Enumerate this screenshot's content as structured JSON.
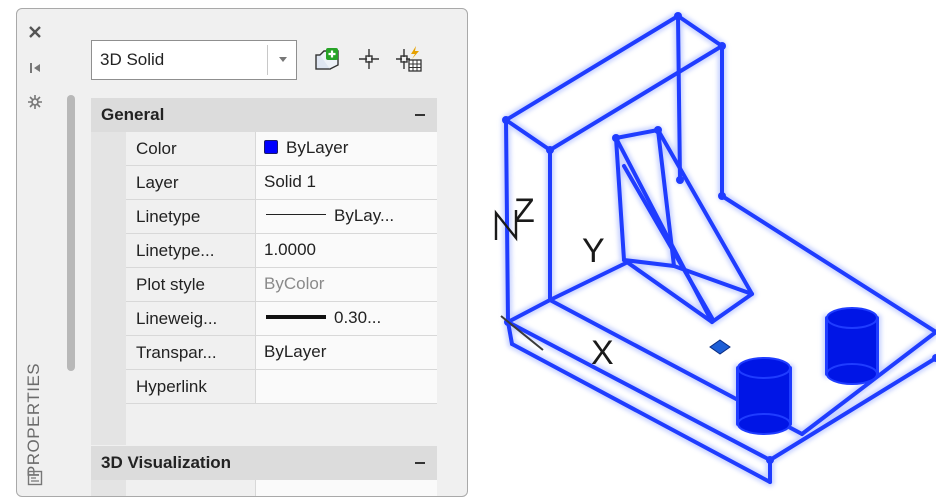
{
  "palette": {
    "title": "PROPERTIES",
    "object_type": "3D Solid",
    "tools": [
      {
        "name": "quick-select-icon"
      },
      {
        "name": "select-objects-icon"
      },
      {
        "name": "toggle-pickadd-icon"
      }
    ],
    "strip_icons": [
      "close-icon",
      "auto-hide-icon",
      "palette-properties-icon",
      "palette-title-icon"
    ]
  },
  "sections": [
    {
      "title": "General",
      "rows": [
        {
          "label": "Color",
          "value": "ByLayer"
        },
        {
          "label": "Layer",
          "value": "Solid 1"
        },
        {
          "label": "Linetype",
          "value": "ByLay..."
        },
        {
          "label": "Linetype...",
          "value": "1.0000"
        },
        {
          "label": "Plot style",
          "value": "ByColor"
        },
        {
          "label": "Lineweig...",
          "value": "0.30..."
        },
        {
          "label": "Transpar...",
          "value": "ByLayer"
        },
        {
          "label": "Hyperlink",
          "value": ""
        }
      ]
    },
    {
      "title": "3D Visualization",
      "rows": []
    }
  ],
  "colors": {
    "swatch": "#0000ff",
    "wireframe": "#1f3cff",
    "wire_glow": "#9fb0ff",
    "cylinder": "#0015e6",
    "grip": "#1e5fd6"
  },
  "drawing": {
    "axis_labels": {
      "x": "X",
      "y": "Y",
      "z": "Z"
    }
  }
}
